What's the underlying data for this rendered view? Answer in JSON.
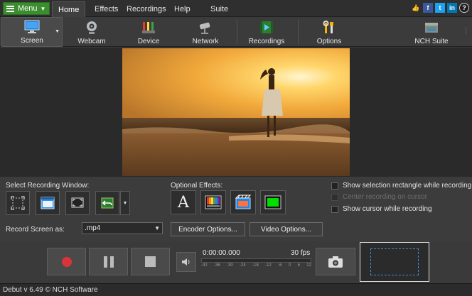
{
  "menubar": {
    "menu_label": "Menu",
    "tabs": [
      "Home",
      "Effects",
      "Recordings",
      "Help",
      "Suite"
    ],
    "active_tab": "Home",
    "social": [
      {
        "icon": "thumbs-up-icon",
        "glyph": "👍"
      },
      {
        "icon": "facebook-icon",
        "glyph": "f"
      },
      {
        "icon": "twitter-icon",
        "glyph": "t"
      },
      {
        "icon": "linkedin-icon",
        "glyph": "in"
      },
      {
        "icon": "help-icon",
        "glyph": "?"
      }
    ]
  },
  "toolbar": {
    "items": [
      {
        "label": "Screen",
        "icon": "monitor-icon"
      },
      {
        "label": "Webcam",
        "icon": "webcam-icon"
      },
      {
        "label": "Device",
        "icon": "device-icon"
      },
      {
        "label": "Network",
        "icon": "network-camera-icon"
      },
      {
        "label": "Recordings",
        "icon": "recordings-icon"
      },
      {
        "label": "Options",
        "icon": "tools-icon"
      },
      {
        "label": "NCH Suite",
        "icon": "nch-suite-icon"
      }
    ]
  },
  "recording_window": {
    "label": "Select Recording Window:",
    "buttons": [
      "select-region-icon",
      "window-icon",
      "fullscreen-icon",
      "undo-region-icon"
    ]
  },
  "effects": {
    "label": "Optional Effects:",
    "buttons": [
      "text-effect-icon",
      "color-bars-icon",
      "video-overlay-icon",
      "green-screen-icon"
    ],
    "text_glyph": "A"
  },
  "options": {
    "show_selection": "Show selection rectangle while recording",
    "center_recording": "Center recording on cursor",
    "show_cursor": "Show cursor while recording"
  },
  "format": {
    "label": "Record Screen as:",
    "value": ".mp4",
    "encoder_button": "Encoder Options...",
    "video_button": "Video Options..."
  },
  "transport": {
    "time": "0:00:00.000",
    "fps": "30 fps",
    "meter_ticks": [
      "-42",
      "-36",
      "-30",
      "-24",
      "-18",
      "-12",
      "-6",
      "0",
      "6",
      "12"
    ]
  },
  "status": {
    "text": "Debut v 6.49 © NCH Software"
  },
  "colors": {
    "accent_green": "#3a8e2e",
    "record_red": "#d9343a",
    "selection_blue": "#3a8fd8"
  }
}
